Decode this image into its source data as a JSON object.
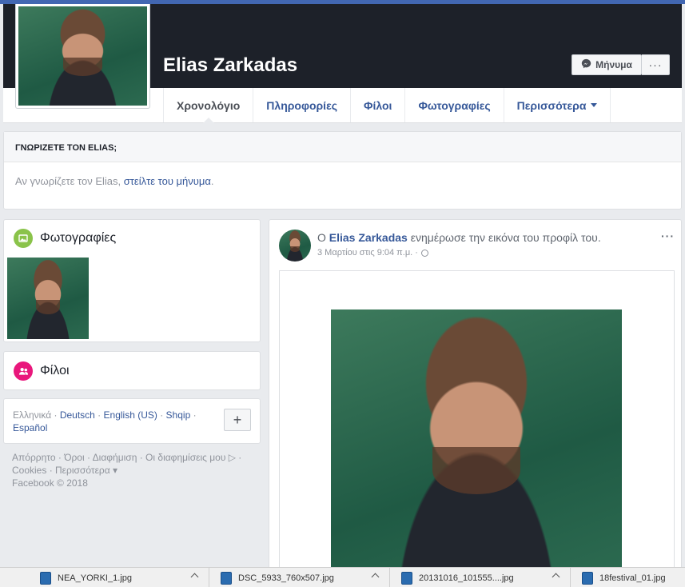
{
  "profile": {
    "name": "Elias Zarkadas",
    "message_label": "Μήνυμα",
    "more_label": "···"
  },
  "nav": {
    "tabs": [
      {
        "label": "Χρονολόγιο",
        "active": true
      },
      {
        "label": "Πληροφορίες"
      },
      {
        "label": "Φίλοι"
      },
      {
        "label": "Φωτογραφίες"
      },
      {
        "label": "Περισσότερα"
      }
    ]
  },
  "know_card": {
    "title": "ΓΝΩΡΙΖΕΤΕ ΤΟΝ ELIAS;",
    "text": "Αν γνωρίζετε τον Elias, ",
    "link": "στείλτε του μήνυμα",
    "suffix": "."
  },
  "photos": {
    "title": "Φωτογραφίες",
    "icon": "photo-icon"
  },
  "friends": {
    "title": "Φίλοι",
    "icon": "friends-icon"
  },
  "languages": {
    "current": "Ελληνικά",
    "sep": " · ",
    "links": [
      "Deutsch",
      "English (US)",
      "Shqip",
      "Español"
    ],
    "plus": "+"
  },
  "footer": {
    "line1": "Απόρρητο · Όροι · Διαφήμιση · Οι διαφημίσεις μου ▷ ·",
    "line2": "Cookies · Περισσότερα ▾",
    "line3": "Facebook © 2018"
  },
  "post": {
    "prefix": "Ο ",
    "author": "Elias Zarkadas",
    "action": " ενημέρωσε την εικόνα του προφίλ του.",
    "time": "3 Μαρτίου στις 9:04 π.μ. ·",
    "menu": "···"
  },
  "downloads": [
    {
      "name": "NEA_YORKI_1.jpg"
    },
    {
      "name": "DSC_5933_760x507.jpg"
    },
    {
      "name": "20131016_101555....jpg"
    },
    {
      "name": "18festival_01.jpg"
    }
  ],
  "colors": {
    "accent": "#4267b2",
    "link": "#365899",
    "cover": "#1d2129"
  }
}
